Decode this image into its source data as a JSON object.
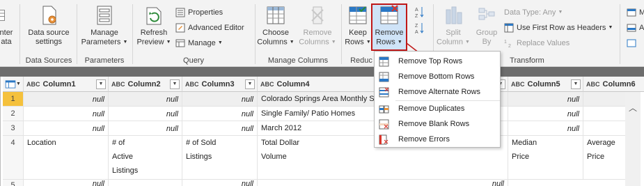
{
  "ribbon": {
    "groups": {
      "data_sources": "Data Sources",
      "parameters": "Parameters",
      "query": "Query",
      "manage_columns": "Manage Columns",
      "reduce": "Reduc",
      "transform": "Transform"
    },
    "enter_data": {
      "line1": "nter",
      "line2": "ata"
    },
    "data_source_settings": {
      "line1": "Data source",
      "line2": "settings"
    },
    "manage_parameters": {
      "line1": "Manage",
      "line2": "Parameters"
    },
    "refresh_preview": {
      "line1": "Refresh",
      "line2": "Preview"
    },
    "properties": "Properties",
    "advanced_editor": "Advanced Editor",
    "manage": "Manage",
    "choose_columns": {
      "line1": "Choose",
      "line2": "Columns"
    },
    "remove_columns": {
      "line1": "Remove",
      "line2": "Columns"
    },
    "keep_rows": {
      "line1": "Keep",
      "line2": "Rows"
    },
    "remove_rows": {
      "line1": "Remove",
      "line2": "Rows"
    },
    "split_column": {
      "line1": "Split",
      "line2": "Column"
    },
    "group_by": {
      "line1": "Group",
      "line2": "By"
    },
    "data_type": "Data Type: Any",
    "use_first_row": "Use First Row as Headers",
    "replace_values": "Replace Values",
    "right_m": "M",
    "right_a": "A"
  },
  "columns": [
    {
      "label": "Column1"
    },
    {
      "label": "Column2"
    },
    {
      "label": "Column3"
    },
    {
      "label": "Column4"
    },
    {
      "label": "Column5"
    },
    {
      "label": "Column6"
    }
  ],
  "type_label": "ABC",
  "rows": [
    {
      "n": "1",
      "c1": "null",
      "c2": "null",
      "c3": "null",
      "c4": "Colorado Springs Area Monthly Sa",
      "c5": "null",
      "c6": ""
    },
    {
      "n": "2",
      "c1": "null",
      "c2": "null",
      "c3": "null",
      "c4": "Single Family/ Patio Homes",
      "c5": "null",
      "c6": ""
    },
    {
      "n": "3",
      "c1": "null",
      "c2": "null",
      "c3": "null",
      "c4": "March 2012",
      "c5": "null",
      "c6": ""
    },
    {
      "n": "4",
      "c1": "Location",
      "c2_l1": "# of",
      "c2_l2": "Active",
      "c2_l3": "Listings",
      "c3_l1": "# of Sold",
      "c3_l2": "Listings",
      "c4_l1": "Total Dollar",
      "c4_l2": "Volume",
      "c5_l1": "Median",
      "c5_l2": "Price",
      "c6_l1": "Average",
      "c6_l2": "Price"
    },
    {
      "n": "5",
      "c1": "null",
      "c3": "null",
      "c4": "null"
    }
  ],
  "menu": {
    "items": [
      "Remove Top Rows",
      "Remove Bottom Rows",
      "Remove Alternate Rows",
      "Remove Duplicates",
      "Remove Blank Rows",
      "Remove Errors"
    ]
  },
  "colors": {
    "accent": "#2b78c5",
    "highlight_border": "#c01818",
    "selected_row": "#f5c13c",
    "red_icon": "#d9352b"
  }
}
